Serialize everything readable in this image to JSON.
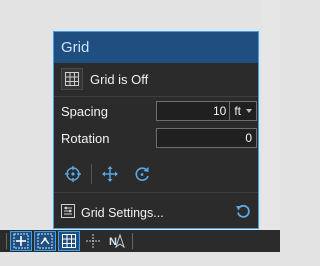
{
  "panel": {
    "title": "Grid",
    "grid_state_label": "Grid is Off",
    "spacing_label": "Spacing",
    "spacing_value": "10",
    "spacing_unit": "ft",
    "rotation_label": "Rotation",
    "rotation_value": "0",
    "tools": [
      {
        "icon": "crosshair-icon",
        "name": "set-origin-tool"
      },
      {
        "icon": "move-icon",
        "name": "move-grid-tool"
      },
      {
        "icon": "rotate-icon",
        "name": "rotate-grid-tool"
      }
    ],
    "settings_label": "Grid Settings...",
    "reset_icon": "reset-icon"
  },
  "statusbar": {
    "buttons": [
      {
        "icon": "snap-icon",
        "active": true
      },
      {
        "icon": "grid-snap-icon",
        "active": true
      },
      {
        "icon": "grid-icon",
        "active": true
      },
      {
        "icon": "crosshair-icon",
        "active": false
      },
      {
        "icon": "north-arrow-icon",
        "active": false
      }
    ]
  },
  "colors": {
    "accent": "#3ca1e6",
    "title_bg": "#1f4e80",
    "panel_bg": "#2b2b2b"
  }
}
